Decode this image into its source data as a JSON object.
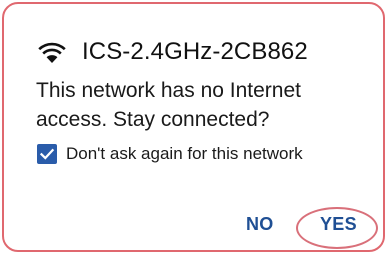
{
  "dialog": {
    "network_name": "ICS-2.4GHz-2CB862",
    "title_icon": "wifi-icon",
    "message": "This network has no Internet access. Stay connected?",
    "checkbox": {
      "label": "Don't ask again for this network",
      "checked": true
    },
    "buttons": {
      "no_label": "NO",
      "yes_label": "YES"
    }
  },
  "colors": {
    "accent": "#1f4f94",
    "checkbox": "#2a5caa",
    "highlight": "#d9707a",
    "border": "#e0686f"
  }
}
